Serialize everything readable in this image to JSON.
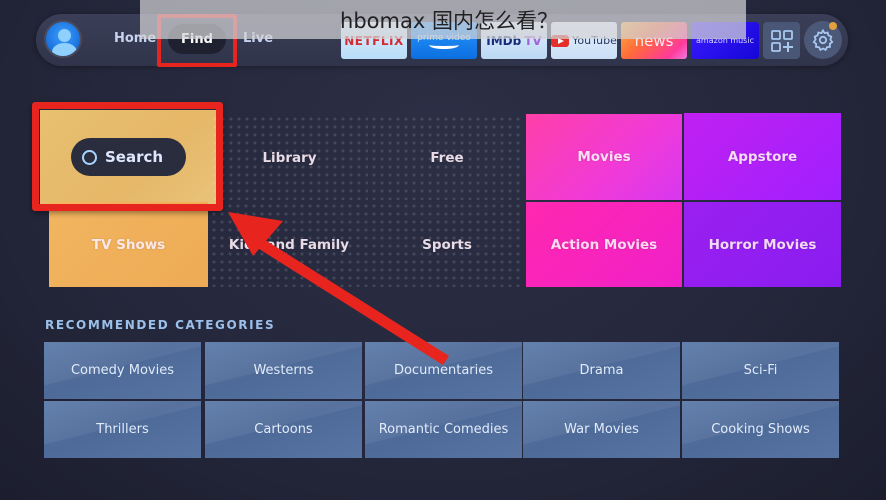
{
  "watermark": {
    "text": "hbomax 国内怎么看？"
  },
  "navbar": {
    "profile": "profile-avatar",
    "links": [
      {
        "label": "Home",
        "active": false
      },
      {
        "label": "Find",
        "active": true
      },
      {
        "label": "Live",
        "active": false
      }
    ],
    "apps": [
      {
        "name": "Netflix",
        "label": "NETFLIX"
      },
      {
        "name": "Prime Video",
        "label": "prime video"
      },
      {
        "name": "IMDb TV",
        "label": "IMDb",
        "label2": "TV"
      },
      {
        "name": "YouTube",
        "label": "YouTube"
      },
      {
        "name": "News",
        "label": "news"
      },
      {
        "name": "Amazon Music",
        "label": "amazon music"
      }
    ],
    "apps_grid_icon": "apps-grid-plus-icon",
    "settings_icon": "gear-icon",
    "notification_dot_color": "#e0a040"
  },
  "hero": {
    "search_label": "Search",
    "tiles": [
      {
        "label": "Library"
      },
      {
        "label": "Free"
      },
      {
        "label": "Movies"
      },
      {
        "label": "Appstore"
      },
      {
        "label": "TV Shows"
      },
      {
        "label": "Kids and Family"
      },
      {
        "label": "Sports"
      },
      {
        "label": "Action Movies"
      },
      {
        "label": "Horror Movies"
      }
    ]
  },
  "recommended": {
    "heading": "RECOMMENDED CATEGORIES",
    "items": [
      "Comedy Movies",
      "Westerns",
      "Documentaries",
      "Drama",
      "Sci-Fi",
      "Thrillers",
      "Cartoons",
      "Romantic Comedies",
      "War Movies",
      "Cooking Shows"
    ]
  },
  "annotations": {
    "highlight_color": "#e8241e",
    "highlighted": [
      "Find",
      "Search"
    ]
  }
}
